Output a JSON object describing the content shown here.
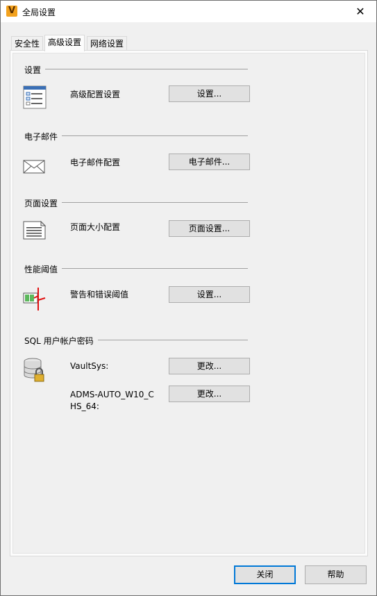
{
  "window": {
    "title": "全局设置",
    "app_icon_letter": "V",
    "close_glyph": "✕"
  },
  "tabs": [
    {
      "label": "安全性"
    },
    {
      "label": "高级设置"
    },
    {
      "label": "网络设置"
    }
  ],
  "active_tab": "高级设置",
  "sections": {
    "settings": {
      "title": "设置",
      "rows": [
        {
          "label": "高级配置设置",
          "button": "设置...",
          "icon": "settings-list-icon"
        }
      ]
    },
    "email": {
      "title": "电子邮件",
      "rows": [
        {
          "label": "电子邮件配置",
          "button": "电子邮件...",
          "icon": "envelope-icon"
        }
      ]
    },
    "page": {
      "title": "页面设置",
      "rows": [
        {
          "label": "页面大小配置",
          "button": "页面设置...",
          "icon": "page-icon"
        }
      ]
    },
    "perf": {
      "title": "性能阈值",
      "rows": [
        {
          "label": "警告和错误阈值",
          "button": "设置...",
          "icon": "threshold-icon"
        }
      ]
    },
    "sql": {
      "title": "SQL 用户帐户密码",
      "rows": [
        {
          "label": "VaultSys:",
          "button": "更改...",
          "icon": "database-lock-icon"
        },
        {
          "label_line1": "ADMS-AUTO_W10_C",
          "label_line2": "HS_64:",
          "button": "更改..."
        }
      ]
    }
  },
  "footer": {
    "close_label": "关闭",
    "help_label": "帮助"
  },
  "colors": {
    "accent": "#0078d7",
    "icon_orange": "#f3a21e",
    "threshold_red": "#e01010",
    "threshold_green": "#5cb85c"
  }
}
